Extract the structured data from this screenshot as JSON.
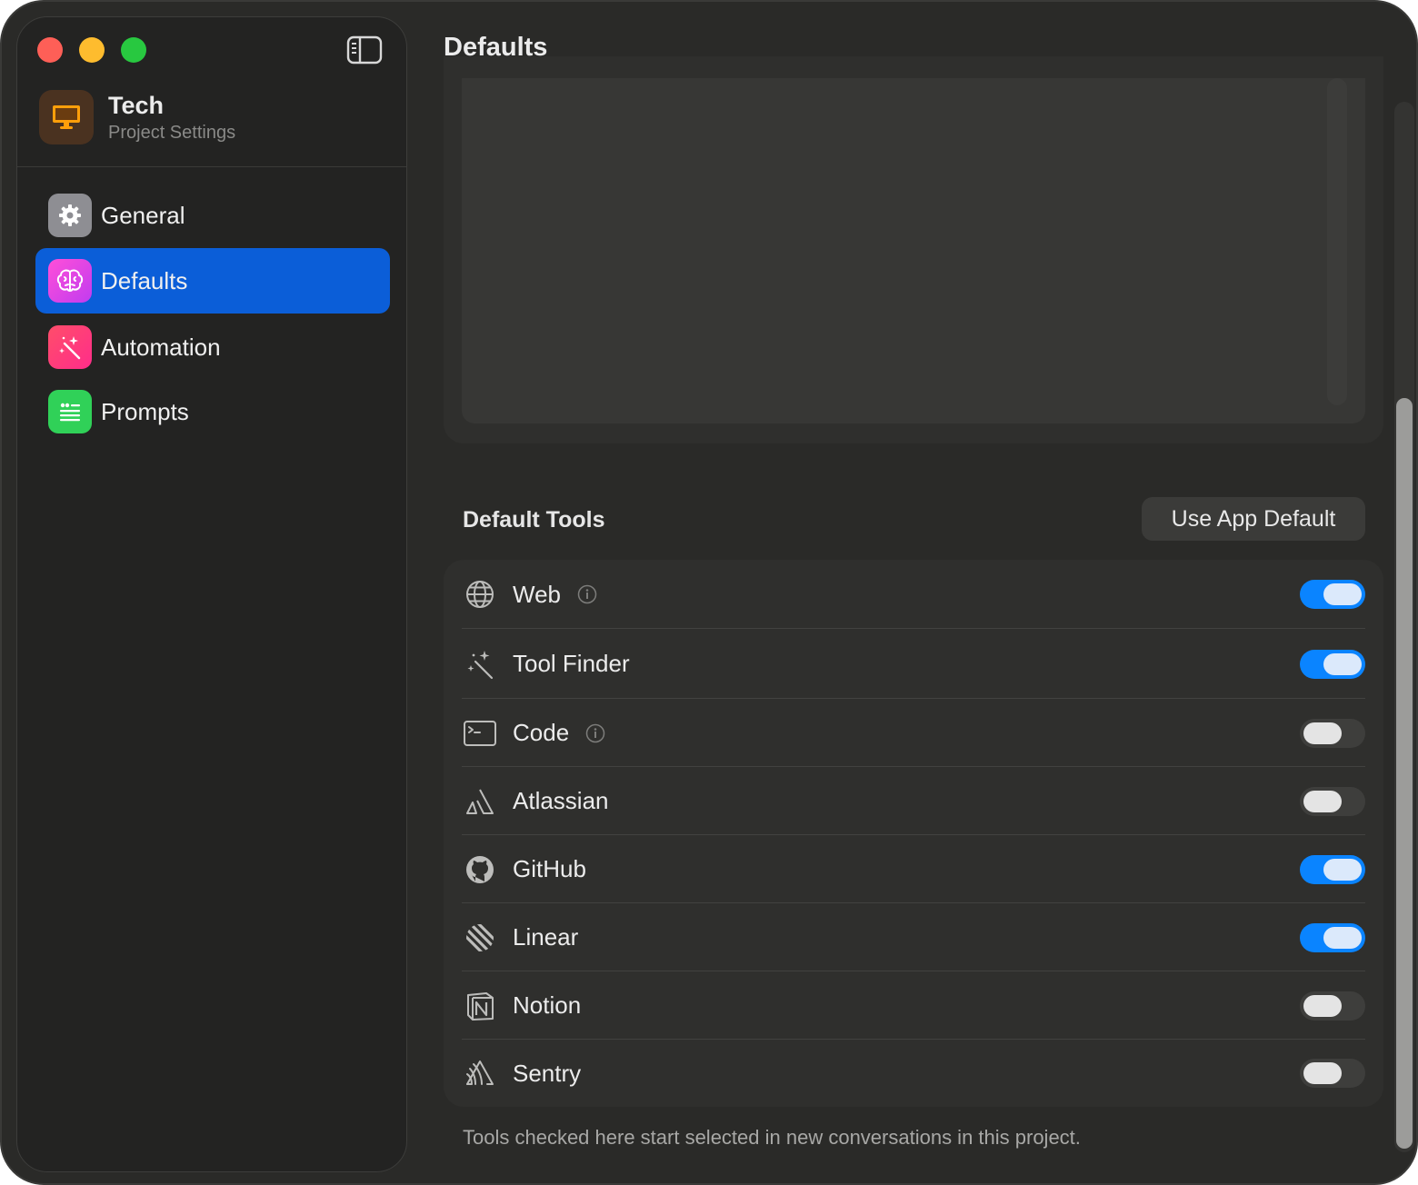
{
  "project": {
    "name": "Tech",
    "subtitle": "Project Settings"
  },
  "sidebar": {
    "items": [
      {
        "label": "General",
        "icon": "gear-icon",
        "color": "#8e8e93",
        "active": false
      },
      {
        "label": "Defaults",
        "icon": "brain-icon",
        "color": "#e040fb",
        "active": true
      },
      {
        "label": "Automation",
        "icon": "magic-wand-icon",
        "color": "#ff2d6f",
        "active": false
      },
      {
        "label": "Prompts",
        "icon": "quote-list-icon",
        "color": "#30d158",
        "active": false
      }
    ]
  },
  "main": {
    "title": "Defaults",
    "tools_section": {
      "title": "Default Tools",
      "app_default_label": "Use App Default",
      "footnote": "Tools checked here start selected in new conversations in this project.",
      "tools": [
        {
          "label": "Web",
          "icon": "globe-icon",
          "info": true,
          "enabled": true
        },
        {
          "label": "Tool Finder",
          "icon": "magic-wand-icon",
          "info": false,
          "enabled": true
        },
        {
          "label": "Code",
          "icon": "terminal-icon",
          "info": true,
          "enabled": false
        },
        {
          "label": "Atlassian",
          "icon": "atlassian-icon",
          "info": false,
          "enabled": false
        },
        {
          "label": "GitHub",
          "icon": "github-icon",
          "info": false,
          "enabled": true
        },
        {
          "label": "Linear",
          "icon": "linear-icon",
          "info": false,
          "enabled": true
        },
        {
          "label": "Notion",
          "icon": "notion-icon",
          "info": false,
          "enabled": false
        },
        {
          "label": "Sentry",
          "icon": "sentry-icon",
          "info": false,
          "enabled": false
        }
      ]
    }
  },
  "colors": {
    "accent": "#0a84ff",
    "selection": "#0b5ed8",
    "window_bg": "#2a2a28",
    "sidebar_bg": "#232322"
  }
}
